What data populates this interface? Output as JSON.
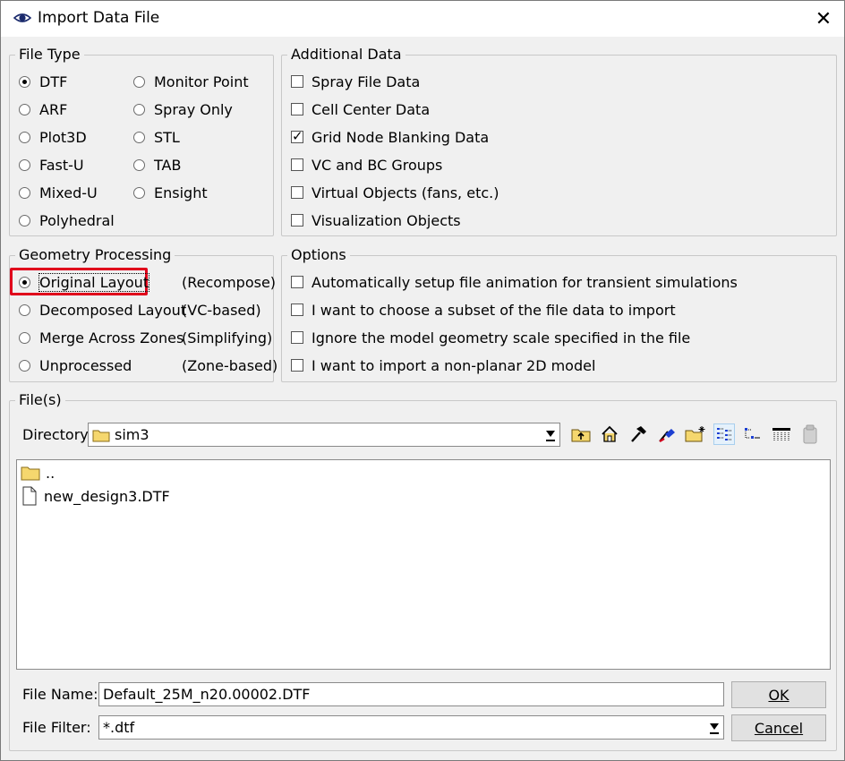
{
  "window": {
    "title": "Import Data File"
  },
  "file_type": {
    "title": "File Type",
    "options": [
      "DTF",
      "ARF",
      "Plot3D",
      "Fast-U",
      "Mixed-U",
      "Polyhedral",
      "Monitor Point",
      "Spray Only",
      "STL",
      "TAB",
      "Ensight"
    ],
    "selected": "DTF"
  },
  "additional_data": {
    "title": "Additional Data",
    "items": [
      {
        "label": "Spray File Data",
        "checked": false
      },
      {
        "label": "Cell Center Data",
        "checked": false
      },
      {
        "label": "Grid Node Blanking Data",
        "checked": true
      },
      {
        "label": "VC and BC Groups",
        "checked": false
      },
      {
        "label": "Virtual Objects (fans, etc.)",
        "checked": false
      },
      {
        "label": "Visualization Objects",
        "checked": false
      }
    ]
  },
  "geometry_processing": {
    "title": "Geometry Processing",
    "options": [
      {
        "label": "Original Layout",
        "note": "(Recompose)",
        "selected": true
      },
      {
        "label": "Decomposed Layout",
        "note": "(VC-based)",
        "selected": false
      },
      {
        "label": "Merge Across Zones",
        "note": "(Simplifying)",
        "selected": false
      },
      {
        "label": "Unprocessed",
        "note": "(Zone-based)",
        "selected": false
      }
    ]
  },
  "options": {
    "title": "Options",
    "items": [
      {
        "label": "Automatically setup file animation for transient simulations",
        "checked": false
      },
      {
        "label": "I want to choose a subset of the file data to import",
        "checked": false
      },
      {
        "label": "Ignore the model geometry scale specified in the file",
        "checked": false
      },
      {
        "label": "I want to import a non-planar 2D model",
        "checked": false
      }
    ]
  },
  "files": {
    "title": "File(s)",
    "directory_label": "Directory:",
    "directory_value": "sim3",
    "toolbar_icons": [
      "up-folder-icon",
      "home-icon",
      "hammer-icon",
      "bookmark-icon",
      "new-folder-icon",
      "list-view-icon",
      "details-view-icon",
      "table-view-icon",
      "clipboard-icon"
    ],
    "entries": [
      {
        "name": "..",
        "type": "folder"
      },
      {
        "name": "new_design3.DTF",
        "type": "file"
      }
    ],
    "file_name_label": "File Name:",
    "file_name_value": "Default_25M_n20.00002.DTF",
    "file_filter_label": "File Filter:",
    "file_filter_value": "*.dtf"
  },
  "buttons": {
    "ok": "OK",
    "cancel": "Cancel"
  },
  "colors": {
    "highlight": "#e0001b",
    "folder": "#f5d76e"
  }
}
